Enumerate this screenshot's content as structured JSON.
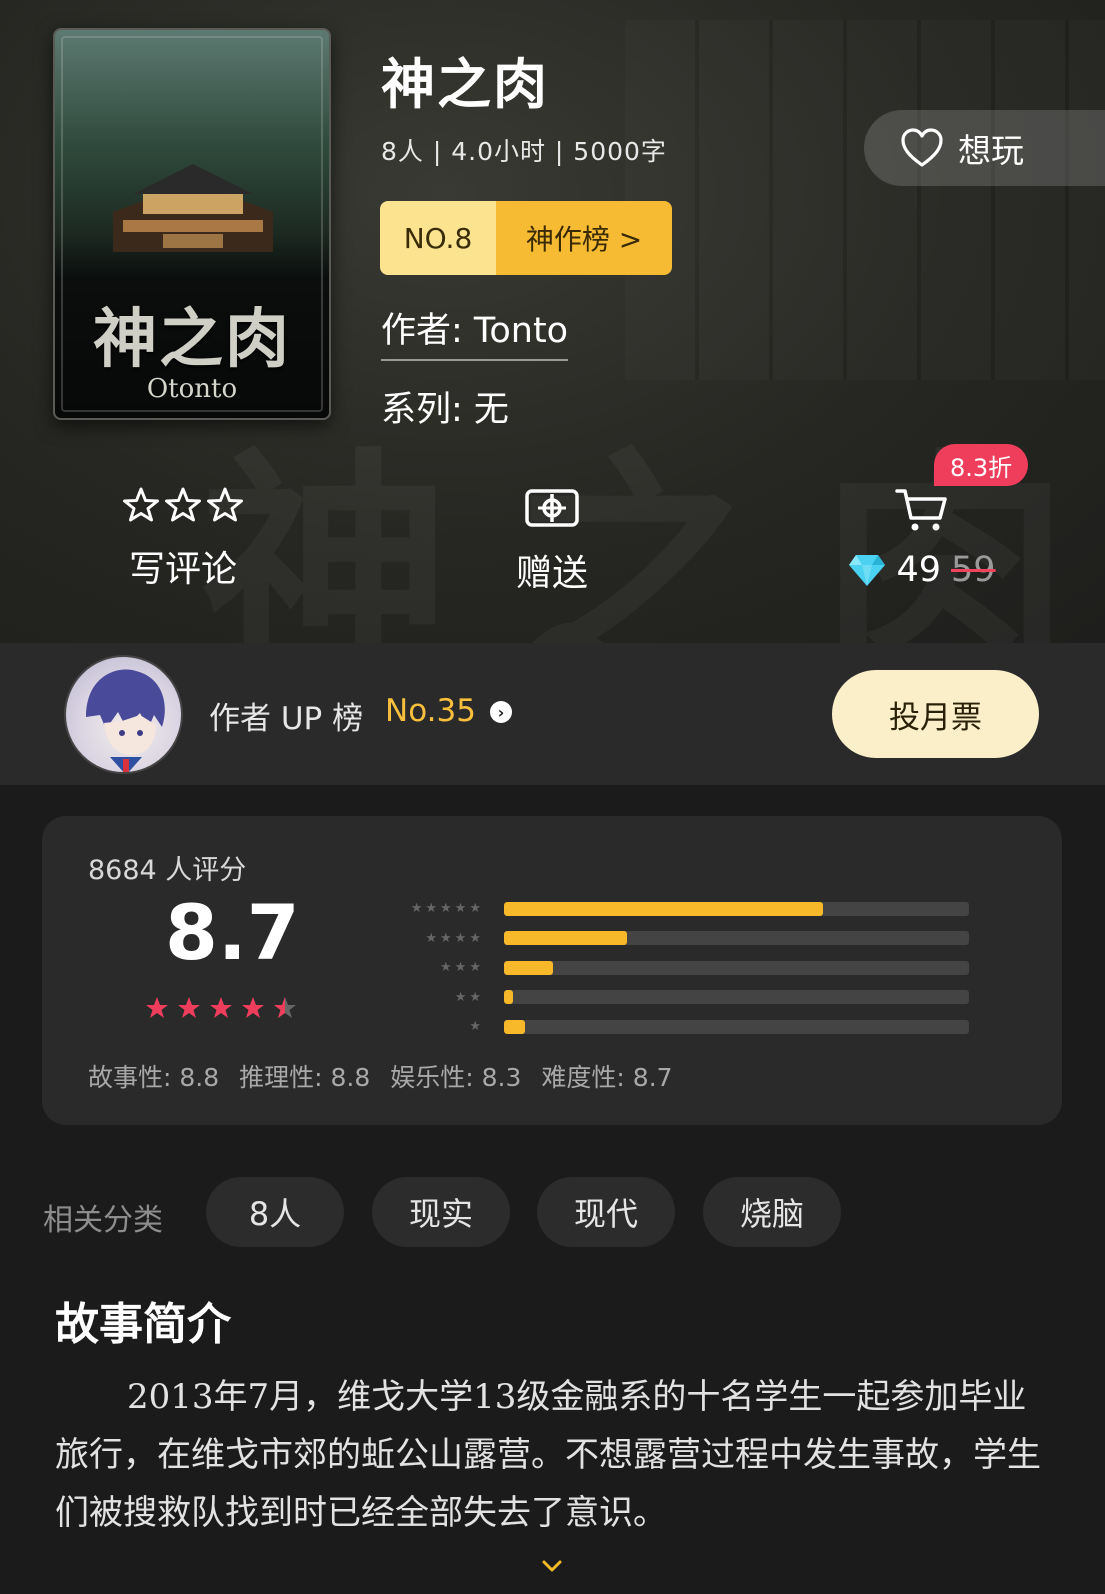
{
  "game": {
    "title": "神之肉",
    "meta": "8人 | 4.0小时 | 5000字",
    "rank_no": "NO.8",
    "rank_list": "神作榜 >",
    "author": "作者: Tonto",
    "series": "系列: 无",
    "cover_title": "神之肉",
    "cover_author": "Otonto"
  },
  "want_label": "想玩",
  "actions": {
    "review_label": "写评论",
    "gift_label": "赠送",
    "discount": "8.3折",
    "price": "49",
    "original_price": "59"
  },
  "author_up": {
    "label": "作者 UP 榜",
    "rank": "No.35",
    "vote_label": "投月票"
  },
  "rating": {
    "count_label": "8684 人评分",
    "score": "8.7",
    "stars": 4.5,
    "distribution": [
      {
        "stars": 5,
        "fraction": 0.685
      },
      {
        "stars": 4,
        "fraction": 0.265
      },
      {
        "stars": 3,
        "fraction": 0.105
      },
      {
        "stars": 2,
        "fraction": 0.02
      },
      {
        "stars": 1,
        "fraction": 0.045
      }
    ],
    "sub_scores": [
      "故事性: 8.8",
      "推理性: 8.8",
      "娱乐性: 8.3",
      "难度性: 8.7"
    ]
  },
  "categories": {
    "label": "相关分类",
    "tags": [
      "8人",
      "现实",
      "现代",
      "烧脑"
    ]
  },
  "story": {
    "heading": "故事简介",
    "text": "2013年7月，维戈大学13级金融系的十名学生一起参加毕业旅行，在维戈市郊的蚯公山露营。不想露营过程中发生事故，学生们被搜救队找到时已经全部失去了意识。"
  },
  "colors": {
    "accent_yellow": "#f7b82a",
    "discount_red": "#ef3e5c",
    "star_red": "#ef3e5c"
  }
}
